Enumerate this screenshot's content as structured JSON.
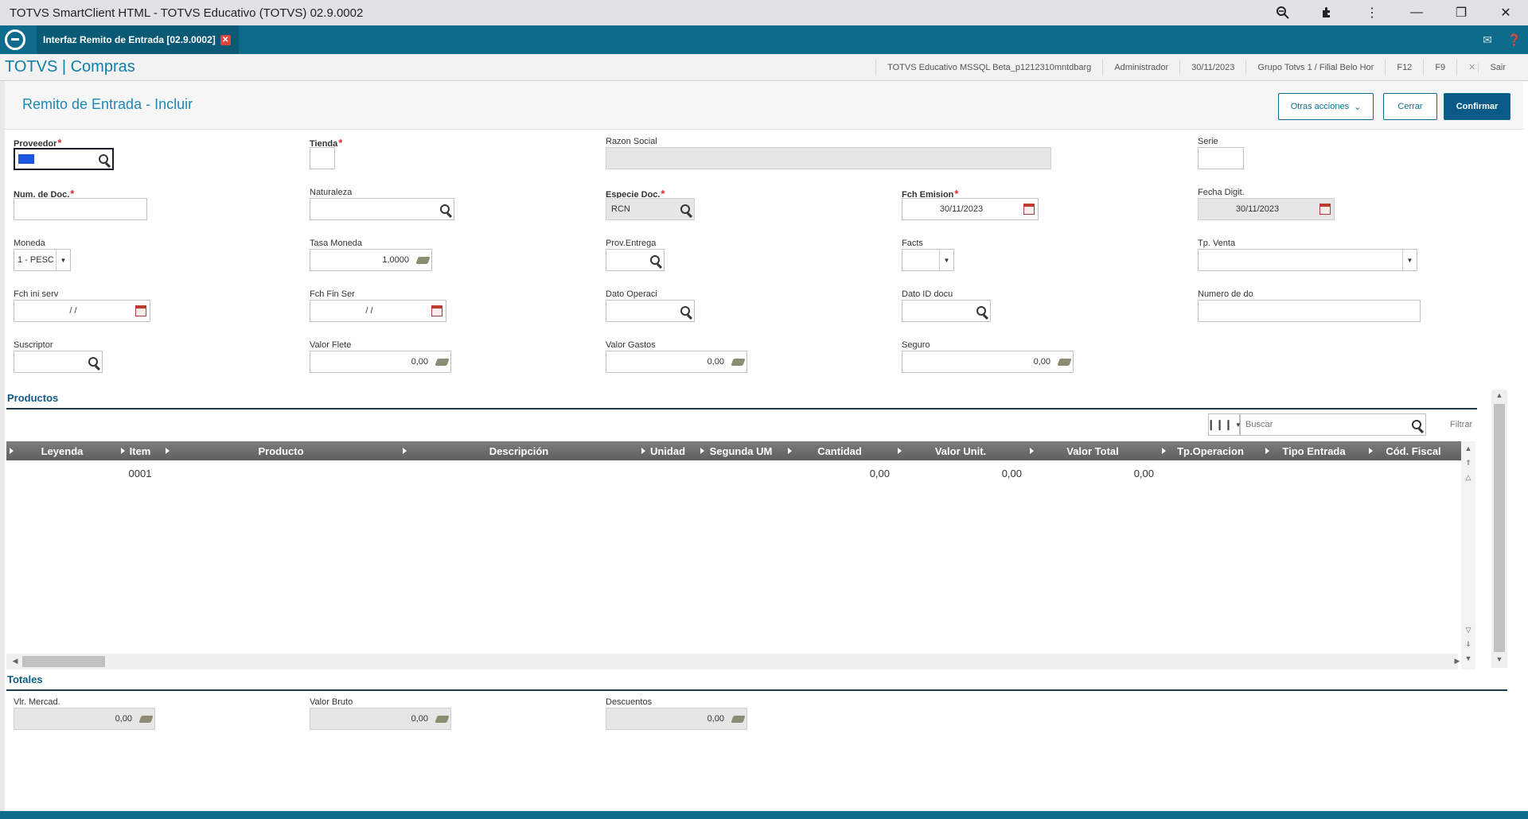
{
  "window": {
    "title": "TOTVS SmartClient HTML - TOTVS Educativo (TOTVS) 02.9.0002",
    "icons": [
      "zoom-icon",
      "extensions-icon",
      "more-icon",
      "minimize-icon",
      "restore-icon",
      "close-icon"
    ]
  },
  "app_tab": {
    "label": "Interfaz Remito de Entrada [02.9.0002]"
  },
  "module": {
    "name": "TOTVS | Compras",
    "env": "TOTVS Educativo MSSQL Beta_p1212310mntdbarg",
    "user": "Administrador",
    "date": "30/11/2023",
    "branch": "Grupo Totvs 1 / Filial Belo Hor",
    "f12": "F12",
    "f9": "F9",
    "exit": "Sair"
  },
  "header": {
    "title": "Remito de Entrada - Incluir",
    "other_actions": "Otras acciones",
    "close": "Cerrar",
    "confirm": "Confirmar"
  },
  "form": {
    "proveedor": {
      "label": "Proveedor",
      "value": ""
    },
    "tienda": {
      "label": "Tienda",
      "value": ""
    },
    "razon_social": {
      "label": "Razon Social",
      "value": ""
    },
    "serie": {
      "label": "Serie",
      "value": ""
    },
    "num_doc": {
      "label": "Num. de Doc.",
      "value": ""
    },
    "naturaleza": {
      "label": "Naturaleza",
      "value": ""
    },
    "especie_doc": {
      "label": "Especie Doc.",
      "value": "RCN"
    },
    "fch_emision": {
      "label": "Fch Emision",
      "value": "30/11/2023"
    },
    "fecha_digit": {
      "label": "Fecha Digit.",
      "value": "30/11/2023"
    },
    "moneda": {
      "label": "Moneda",
      "value": "1 - PESC"
    },
    "tasa_moneda": {
      "label": "Tasa Moneda",
      "value": "1,0000"
    },
    "prov_entrega": {
      "label": "Prov.Entrega",
      "value": ""
    },
    "facts": {
      "label": "Facts",
      "value": ""
    },
    "tp_venta": {
      "label": "Tp. Venta",
      "value": ""
    },
    "fch_ini_serv": {
      "label": "Fch ini serv",
      "value": "/ /"
    },
    "fch_fin_ser": {
      "label": "Fch Fin Ser",
      "value": "/ /"
    },
    "dato_operaci": {
      "label": "Dato Operaci",
      "value": ""
    },
    "dato_id_docu": {
      "label": "Dato ID docu",
      "value": ""
    },
    "numero_de_do": {
      "label": "Numero de do",
      "value": ""
    },
    "suscriptor": {
      "label": "Suscriptor",
      "value": ""
    },
    "valor_flete": {
      "label": "Valor Flete",
      "value": "0,00"
    },
    "valor_gastos": {
      "label": "Valor Gastos",
      "value": "0,00"
    },
    "seguro": {
      "label": "Seguro",
      "value": "0,00"
    }
  },
  "productos": {
    "title": "Productos",
    "search_placeholder": "Buscar",
    "filter_label": "Filtrar",
    "columns": [
      "Leyenda",
      "Item",
      "Producto",
      "Descripción",
      "Unidad",
      "Segunda UM",
      "Cantidad",
      "Valor Unit.",
      "Valor Total",
      "Tp.Operacion",
      "Tipo Entrada",
      "Cód. Fiscal"
    ],
    "rows": [
      {
        "item": "0001",
        "cantidad": "0,00",
        "valor_unit": "0,00",
        "valor_total": "0,00"
      }
    ]
  },
  "totales": {
    "title": "Totales",
    "vlr_mercad": {
      "label": "Vlr. Mercad.",
      "value": "0,00"
    },
    "valor_bruto": {
      "label": "Valor Bruto",
      "value": "0,00"
    },
    "descuentos": {
      "label": "Descuentos",
      "value": "0,00"
    }
  },
  "colors": {
    "accent": "#0f6b8c",
    "primary_button": "#0a5a87",
    "required": "#e0262d"
  }
}
